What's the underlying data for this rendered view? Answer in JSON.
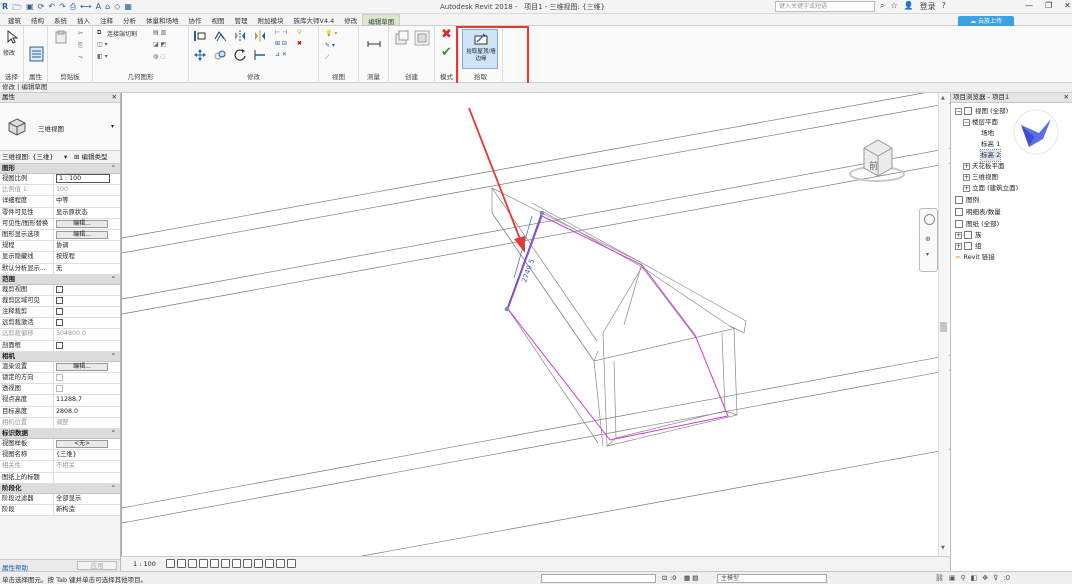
{
  "window": {
    "title": "Autodesk Revit 2018 -",
    "doc_title": "项目1 - 三维视图: {三维}",
    "search_placeholder": "键入关键字或短语",
    "login": "登录",
    "minimize": "—",
    "restore": "❐",
    "close": "✕"
  },
  "tabs": [
    {
      "label": "建筑"
    },
    {
      "label": "结构"
    },
    {
      "label": "系统"
    },
    {
      "label": "插入"
    },
    {
      "label": "注释"
    },
    {
      "label": "分析"
    },
    {
      "label": "体量和场地"
    },
    {
      "label": "协作"
    },
    {
      "label": "视图"
    },
    {
      "label": "管理"
    },
    {
      "label": "附加模块"
    },
    {
      "label": "族库大师V4.4"
    },
    {
      "label": "修改"
    },
    {
      "label": "编辑草图"
    }
  ],
  "ribbon": {
    "modify_label": "修改",
    "select_label": "选择",
    "properties_label": "属性",
    "clipboard_label": "剪贴板",
    "geometry_label": "几何图形",
    "geometry_join": "连接端切割",
    "modify_group_label": "修改",
    "view_label": "视图",
    "measure_label": "测量",
    "create_label": "创建",
    "mode_label": "模式",
    "pick_group_label": "拾取",
    "pick_walls_label": "拾取屋顶/墙边缘",
    "cloud_button": "云族上传"
  },
  "mode_bar": "修改 | 编辑草图",
  "properties": {
    "panel_title": "属性",
    "type_name": "三维视图",
    "instance_selector": "三维视图: {三维}",
    "edit_type": "编辑类型",
    "sections": [
      {
        "title": "图形",
        "rows": [
          {
            "k": "视图比例",
            "v": "1 : 100",
            "kind": "field"
          },
          {
            "k": "比例值 1:",
            "v": "100",
            "kind": "dim"
          },
          {
            "k": "详细程度",
            "v": "中等",
            "kind": "text"
          },
          {
            "k": "零件可见性",
            "v": "显示原状态",
            "kind": "text"
          },
          {
            "k": "可见性/图形替换",
            "v": "编辑...",
            "kind": "button"
          },
          {
            "k": "图形显示选项",
            "v": "编辑...",
            "kind": "button"
          },
          {
            "k": "规程",
            "v": "协调",
            "kind": "text"
          },
          {
            "k": "显示隐藏线",
            "v": "按规程",
            "kind": "text"
          },
          {
            "k": "默认分析显示...",
            "v": "无",
            "kind": "text"
          }
        ]
      },
      {
        "title": "范围",
        "rows": [
          {
            "k": "裁剪视图",
            "v": "",
            "kind": "check"
          },
          {
            "k": "裁剪区域可见",
            "v": "",
            "kind": "check"
          },
          {
            "k": "注释裁剪",
            "v": "",
            "kind": "check"
          },
          {
            "k": "远剪裁激活",
            "v": "",
            "kind": "check"
          },
          {
            "k": "远剪裁偏移",
            "v": "304800.0",
            "kind": "dim"
          },
          {
            "k": "剖面框",
            "v": "",
            "kind": "check"
          }
        ]
      },
      {
        "title": "相机",
        "rows": [
          {
            "k": "渲染设置",
            "v": "编辑...",
            "kind": "button"
          },
          {
            "k": "锁定的方向",
            "v": "",
            "kind": "checkdim"
          },
          {
            "k": "透视图",
            "v": "",
            "kind": "checkdim"
          },
          {
            "k": "视点高度",
            "v": "11288.7",
            "kind": "text"
          },
          {
            "k": "目标高度",
            "v": "2808.0",
            "kind": "text"
          },
          {
            "k": "相机位置",
            "v": "调整",
            "kind": "dim"
          }
        ]
      },
      {
        "title": "标识数据",
        "rows": [
          {
            "k": "视图样板",
            "v": "<无>",
            "kind": "button"
          },
          {
            "k": "视图名称",
            "v": "{三维}",
            "kind": "text"
          },
          {
            "k": "相关性",
            "v": "不相关",
            "kind": "dim"
          },
          {
            "k": "图纸上的标题",
            "v": "",
            "kind": "text"
          }
        ]
      },
      {
        "title": "阶段化",
        "rows": [
          {
            "k": "阶段过滤器",
            "v": "全部显示",
            "kind": "text"
          },
          {
            "k": "阶段",
            "v": "新构造",
            "kind": "text"
          }
        ]
      }
    ],
    "help_link": "属性帮助",
    "apply": "应用"
  },
  "viewport": {
    "dimension": "2749.5",
    "viewcube_face": "前",
    "scale": "1 : 100"
  },
  "browser": {
    "title": "项目浏览器 - 项目1",
    "nodes": [
      {
        "label": "视图 (全部)",
        "toggle": "−",
        "icon": true
      },
      {
        "label": "楼层平面",
        "toggle": "−",
        "icon": false
      },
      {
        "label": "场地",
        "toggle": "",
        "icon": false
      },
      {
        "label": "标高 1",
        "toggle": "",
        "icon": false
      },
      {
        "label": "标高 2",
        "toggle": "",
        "icon": false
      },
      {
        "label": "天花板平面",
        "toggle": "+",
        "icon": false
      },
      {
        "label": "三维视图",
        "toggle": "+",
        "icon": false
      },
      {
        "label": "立面 (建筑立面)",
        "toggle": "+",
        "icon": false
      },
      {
        "label": "图例",
        "toggle": "",
        "icon": true
      },
      {
        "label": "明细表/数量",
        "toggle": "",
        "icon": true
      },
      {
        "label": "图纸 (全部)",
        "toggle": "",
        "icon": true
      },
      {
        "label": "族",
        "toggle": "+",
        "icon": true
      },
      {
        "label": "组",
        "toggle": "+",
        "icon": true
      },
      {
        "label": "Revit 链接",
        "toggle": "",
        "icon": false
      }
    ]
  },
  "status": {
    "message": "单击选择图元。按 Tab 键并单击可选择其他项目。",
    "model": "主模型",
    "zero": ":0"
  },
  "colors": {
    "accent": "#1a5fb4",
    "highlight_box": "#e53935",
    "sketch_line": "#d63ad6",
    "selection_blue": "#3a64c8",
    "cloud_button": "#3ba2e6"
  }
}
